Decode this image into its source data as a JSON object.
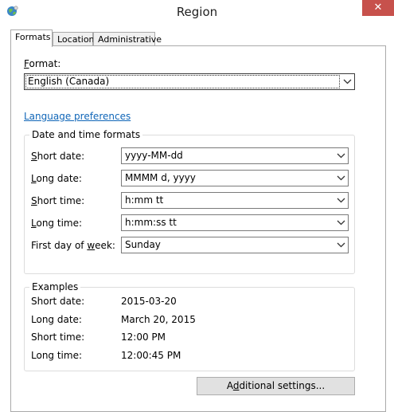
{
  "window": {
    "title": "Region",
    "close_label": "✕",
    "icon": "globe-icon"
  },
  "tabs": [
    {
      "label": "Formats",
      "active": true
    },
    {
      "label": "Location",
      "active": false
    },
    {
      "label": "Administrative",
      "active": false
    }
  ],
  "format": {
    "label": "Format:",
    "label_access_key": "F",
    "label_rest": "ormat:",
    "value": "English (Canada)"
  },
  "language_link": "Language preferences",
  "date_time": {
    "group_title": "Date and time formats",
    "rows": [
      {
        "label_key": "S",
        "label_rest": "hort date:",
        "value": "yyyy-MM-dd"
      },
      {
        "label_key": "L",
        "label_rest": "ong date:",
        "value": "MMMM d, yyyy"
      },
      {
        "label_key": "S",
        "label_rest": "hort time:",
        "value": "h:mm tt"
      },
      {
        "label_key": "L",
        "label_rest": "ong time:",
        "value": "h:mm:ss tt"
      },
      {
        "label_pre": "First day of ",
        "label_key": "w",
        "label_rest": "eek:",
        "value": "Sunday"
      }
    ]
  },
  "examples": {
    "group_title": "Examples",
    "rows": [
      {
        "label": "Short date:",
        "value": "2015-03-20"
      },
      {
        "label": "Long date:",
        "value": "March 20, 2015"
      },
      {
        "label": "Short time:",
        "value": "12:00 PM"
      },
      {
        "label": "Long time:",
        "value": "12:00:45 PM"
      }
    ]
  },
  "additional_settings": {
    "pre": "A",
    "key": "d",
    "rest": "ditional settings..."
  },
  "colors": {
    "close": "#c7514c",
    "link": "#1066b8"
  }
}
